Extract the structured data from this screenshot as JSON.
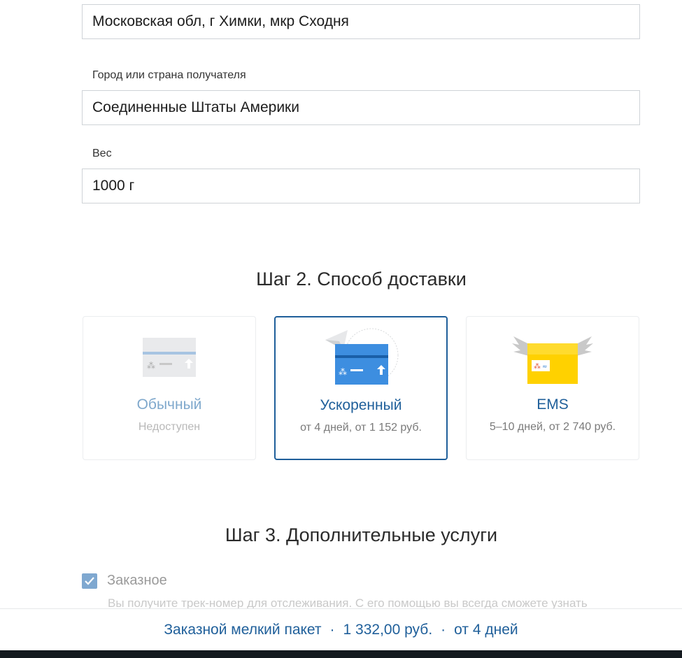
{
  "form": {
    "from_value": "Московская обл, г Химки, мкр Сходня",
    "to_label": "Город или страна получателя",
    "to_value": "Соединенные Штаты Америки",
    "weight_label": "Вес",
    "weight_value": "1000 г"
  },
  "step2": {
    "title": "Шаг 2. Способ доставки",
    "options": [
      {
        "name": "Обычный",
        "sub": "Недоступен",
        "state": "disabled",
        "icon": "regular-parcel-icon"
      },
      {
        "name": "Ускоренный",
        "sub": "от 4 дней, от 1 152 руб.",
        "state": "selected",
        "icon": "express-parcel-icon"
      },
      {
        "name": "EMS",
        "sub": "5–10 дней, от 2 740 руб.",
        "state": "available",
        "icon": "ems-box-icon"
      }
    ]
  },
  "step3": {
    "title": "Шаг 3. Дополнительные услуги",
    "registered_label": "Заказное",
    "registered_checked": true,
    "registered_desc": "Вы получите трек-номер для отслеживания. С его помощью вы всегда сможете узнать"
  },
  "summary": {
    "type": "Заказной мелкий пакет",
    "price": "1 332,00 руб.",
    "term": "от 4 дней",
    "separator": "·"
  },
  "colors": {
    "accent": "#1f5f9a",
    "ems_yellow": "#ffd100"
  }
}
